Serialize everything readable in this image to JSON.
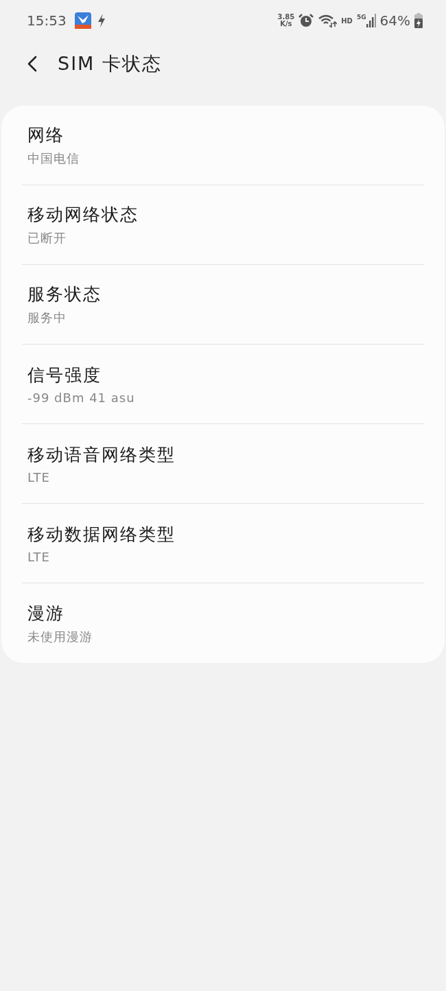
{
  "status_bar": {
    "time": "15:53",
    "speed_value": "3.85",
    "speed_unit": "K/s",
    "hd": "HD",
    "network": "5G",
    "battery": "64%"
  },
  "header": {
    "title": "SIM 卡状态"
  },
  "items": [
    {
      "title": "网络",
      "value": "中国电信"
    },
    {
      "title": "移动网络状态",
      "value": "已断开"
    },
    {
      "title": "服务状态",
      "value": "服务中"
    },
    {
      "title": "信号强度",
      "value": "-99 dBm 41 asu"
    },
    {
      "title": "移动语音网络类型",
      "value": "LTE"
    },
    {
      "title": "移动数据网络类型",
      "value": "LTE"
    },
    {
      "title": "漫游",
      "value": "未使用漫游"
    }
  ]
}
